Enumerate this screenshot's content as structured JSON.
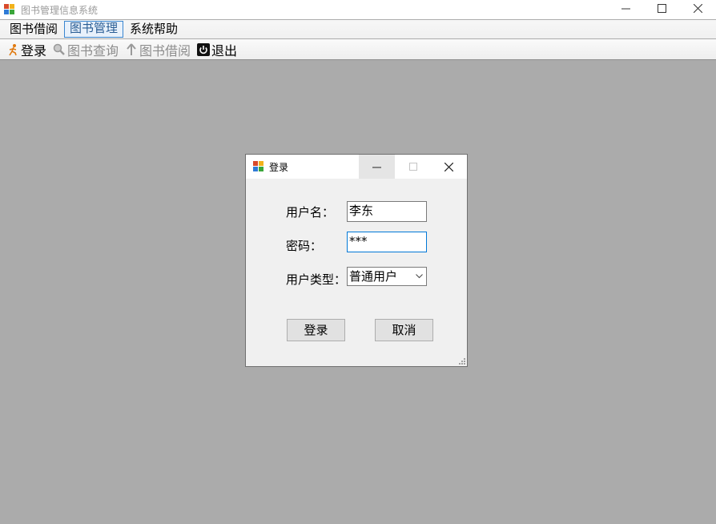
{
  "window": {
    "title": "图书管理信息系统",
    "controls": {
      "minimize": "—",
      "maximize": "☐",
      "close": "✕"
    }
  },
  "menubar": {
    "items": [
      "图书借阅",
      "图书管理",
      "系统帮助"
    ]
  },
  "toolbar": {
    "items": [
      {
        "label": "登录",
        "icon": "run-icon",
        "enabled": true
      },
      {
        "label": "图书查询",
        "icon": "magnifier-icon",
        "enabled": false
      },
      {
        "label": "图书借阅",
        "icon": "up-arrow-icon",
        "enabled": false
      },
      {
        "label": "退出",
        "icon": "power-icon",
        "enabled": true
      }
    ]
  },
  "dialog": {
    "title": "登录",
    "username_label": "用户名：",
    "username_value": "李东",
    "password_label": "密码：",
    "password_value": "***",
    "usertype_label": "用户类型：",
    "usertype_value": "普通用户",
    "login_button": "登录",
    "cancel_button": "取消"
  },
  "colors": {
    "desktop": "#ababab",
    "accent": "#0078d7"
  }
}
